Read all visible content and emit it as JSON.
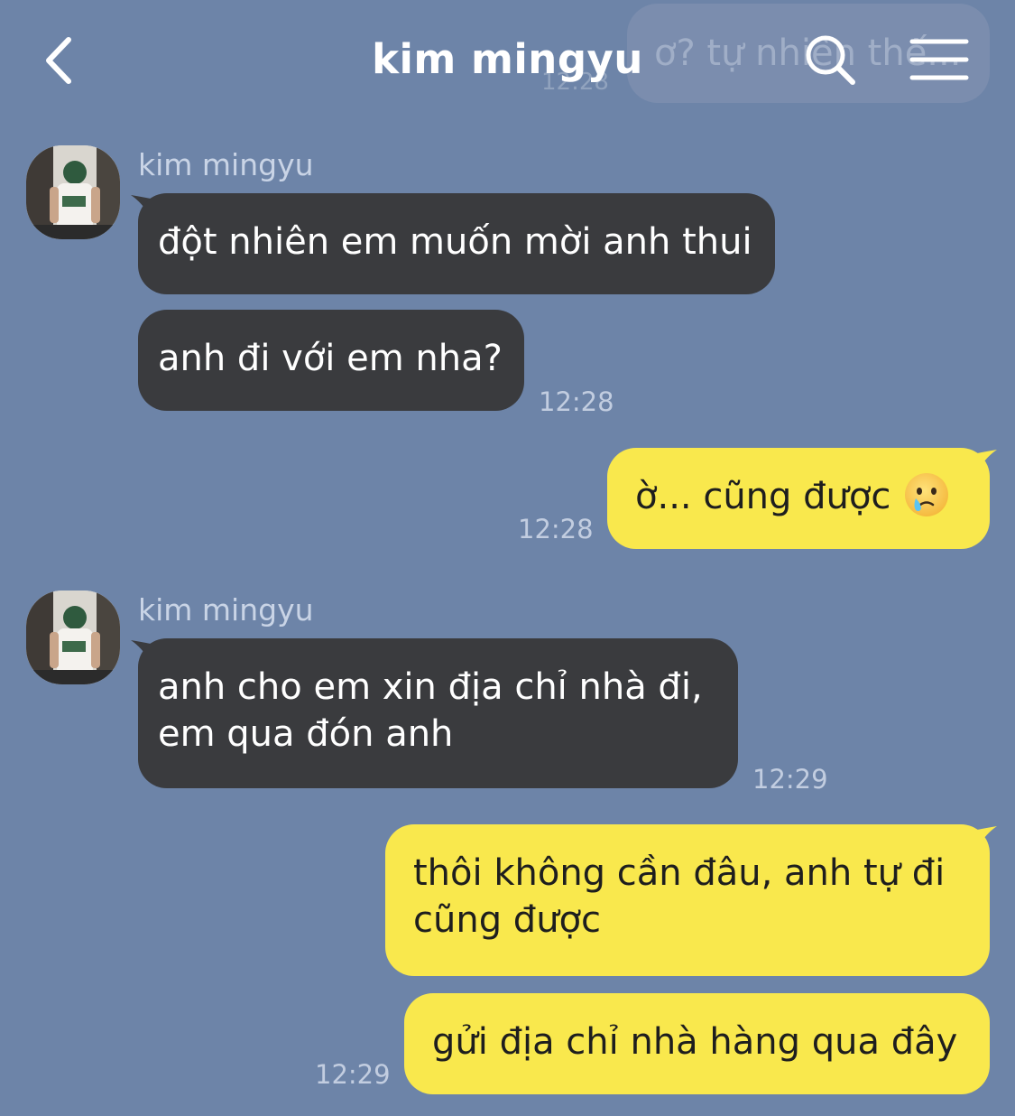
{
  "header": {
    "title": "kim mingyu",
    "ghost_preview_text": "ơ? tự nhiên thế...",
    "ghost_preview_time": "12:28"
  },
  "messages": [
    {
      "direction": "in",
      "sender": "kim mingyu",
      "lines": [
        "đột nhiên em muốn mời anh thui"
      ]
    },
    {
      "direction": "in",
      "lines": [
        "anh đi với em nha?"
      ],
      "time": "12:28"
    },
    {
      "direction": "out",
      "lines": [
        "ờ... cũng được"
      ],
      "emoji": "crying-face-icon",
      "time": "12:28"
    },
    {
      "direction": "in",
      "sender": "kim mingyu",
      "lines": [
        "anh cho em xin địa chỉ nhà đi,",
        "em qua đón anh"
      ],
      "time": "12:29"
    },
    {
      "direction": "out",
      "lines": [
        "thôi không cần đâu, anh tự đi",
        "cũng được"
      ]
    },
    {
      "direction": "out",
      "lines": [
        "gửi địa chỉ nhà hàng qua đây"
      ],
      "time": "12:29"
    }
  ],
  "colors": {
    "background": "#6d84a8",
    "incoming_bubble": "#3a3b3e",
    "outgoing_bubble": "#f9e84d",
    "title_text": "#ffffff",
    "meta_text": "#c2cde0"
  },
  "icons": [
    "chevron-left-icon",
    "search-icon",
    "hamburger-menu-icon",
    "crying-face-icon",
    "avatar-photo"
  ]
}
